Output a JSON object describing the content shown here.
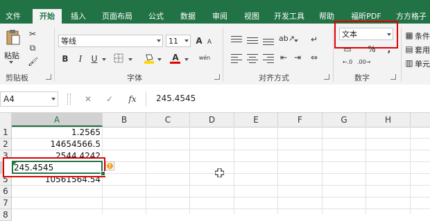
{
  "tabs": [
    {
      "label": "文件",
      "active": false
    },
    {
      "label": "开始",
      "active": true
    },
    {
      "label": "插入",
      "active": false
    },
    {
      "label": "页面布局",
      "active": false
    },
    {
      "label": "公式",
      "active": false
    },
    {
      "label": "数据",
      "active": false
    },
    {
      "label": "审阅",
      "active": false
    },
    {
      "label": "视图",
      "active": false
    },
    {
      "label": "开发工具",
      "active": false
    },
    {
      "label": "帮助",
      "active": false
    },
    {
      "label": "福昕PDF",
      "active": false
    },
    {
      "label": "方方格子",
      "active": false
    }
  ],
  "ribbon": {
    "clipboard": {
      "paste_label": "粘贴",
      "group_label": "剪贴板"
    },
    "font": {
      "font_name": "等线",
      "font_size": "11",
      "bold": "B",
      "italic": "I",
      "underline": "U",
      "grow": "A",
      "shrink": "A",
      "font_color_letter": "A",
      "phonetic": "wén",
      "group_label": "字体"
    },
    "alignment": {
      "group_label": "对齐方式"
    },
    "number": {
      "format_value": "文本",
      "percent": "%",
      "comma": ",",
      "group_label": "数字"
    },
    "styles": {
      "conditional": "条件",
      "table": "套用",
      "cell": "单元"
    }
  },
  "formula_bar": {
    "name_box": "A4",
    "fx": "fx",
    "value": "245.4545"
  },
  "columns": [
    "A",
    "B",
    "C",
    "D",
    "E",
    "F",
    "G",
    "H"
  ],
  "rows": [
    "1",
    "2",
    "3",
    "4",
    "5",
    "6",
    "7",
    "8"
  ],
  "cells": {
    "A1": "1.2565",
    "A2": "14654566.5",
    "A3": "2544.4242",
    "A4": "245.4545",
    "A5": "10561564.54"
  },
  "warning_glyph": "!",
  "colors": {
    "accent": "#217346",
    "highlight": "#e00000",
    "fill_yellow": "#ffd800",
    "font_red": "#e00000"
  }
}
